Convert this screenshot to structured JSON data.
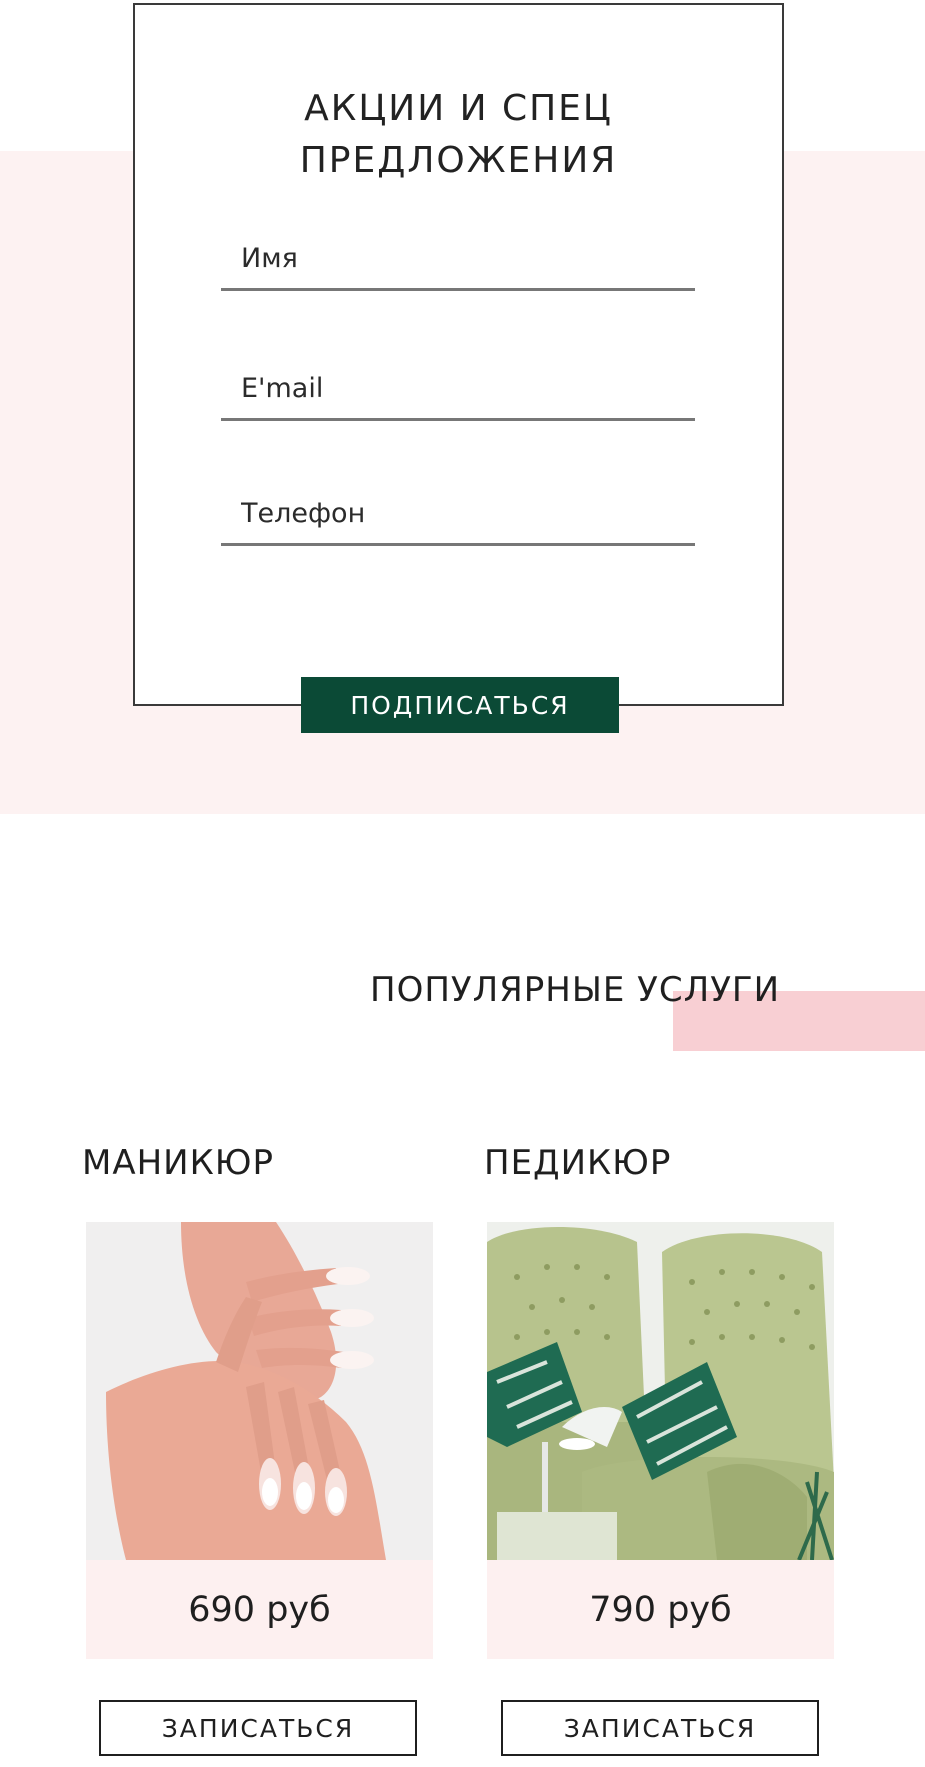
{
  "subscribe_form": {
    "title_line1": "АКЦИИ И СПЕЦ",
    "title_line2": "ПРЕДЛОЖЕНИЯ",
    "name_placeholder": "Имя",
    "email_placeholder": "E'mail",
    "phone_placeholder": "Телефон",
    "submit_label": "ПОДПИСАТЬСЯ"
  },
  "popular_services": {
    "title": "ПОПУЛЯРНЫЕ УСЛУГИ",
    "items": [
      {
        "name": "МАНИКЮР",
        "price": "690 руб",
        "button_label": "ЗАПИСАТЬСЯ",
        "image": "manicure-photo"
      },
      {
        "name": "ПЕДИКЮР",
        "price": "790 руб",
        "button_label": "ЗАПИСАТЬСЯ",
        "image": "pedicure-photo"
      }
    ]
  },
  "colors": {
    "accent_green": "#0b4a36",
    "band_pink": "#fdf2f2",
    "accent_pink": "#f8cfd3"
  }
}
